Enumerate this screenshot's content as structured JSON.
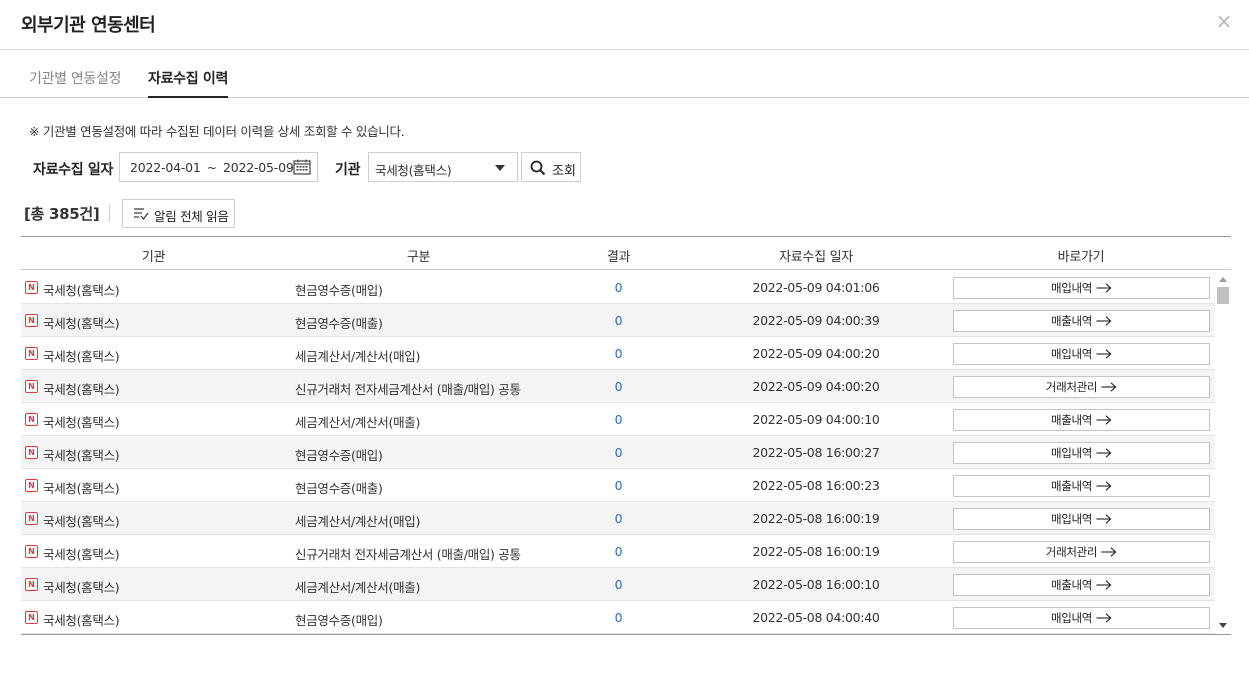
{
  "window": {
    "title": "외부기관 연동센터",
    "close_glyph": "×"
  },
  "tabs": [
    {
      "label": "기관별 연동설정",
      "active": false
    },
    {
      "label": "자료수집 이력",
      "active": true
    }
  ],
  "notice": "※ 기관별 연동설정에 따라 수집된 데이터 이력을 상세 조회할 수 있습니다.",
  "filters": {
    "date_label": "자료수집 일자",
    "date_from": "2022-04-01",
    "date_sep": "~",
    "date_to": "2022-05-09",
    "org_label": "기관",
    "org_value": "국세청(홈택스)",
    "search_label": "조회"
  },
  "summary": {
    "count_text": "[총 385건]",
    "read_all_label": "알림 전체 읽음"
  },
  "table": {
    "headers": [
      "기관",
      "구분",
      "결과",
      "자료수집 일자",
      "바로가기"
    ],
    "rows": [
      {
        "org": "국세청(홈택스)",
        "type": "현금영수증(매입)",
        "result": "0",
        "date": "2022-05-09 04:01:06",
        "link": "매입내역"
      },
      {
        "org": "국세청(홈택스)",
        "type": "현금영수증(매출)",
        "result": "0",
        "date": "2022-05-09 04:00:39",
        "link": "매출내역"
      },
      {
        "org": "국세청(홈택스)",
        "type": "세금계산서/계산서(매입)",
        "result": "0",
        "date": "2022-05-09 04:00:20",
        "link": "매입내역"
      },
      {
        "org": "국세청(홈택스)",
        "type": "신규거래처 전자세금계산서 (매출/매입) 공통",
        "result": "0",
        "date": "2022-05-09 04:00:20",
        "link": "거래처관리"
      },
      {
        "org": "국세청(홈택스)",
        "type": "세금계산서/계산서(매출)",
        "result": "0",
        "date": "2022-05-09 04:00:10",
        "link": "매출내역"
      },
      {
        "org": "국세청(홈택스)",
        "type": "현금영수증(매입)",
        "result": "0",
        "date": "2022-05-08 16:00:27",
        "link": "매입내역"
      },
      {
        "org": "국세청(홈택스)",
        "type": "현금영수증(매출)",
        "result": "0",
        "date": "2022-05-08 16:00:23",
        "link": "매출내역"
      },
      {
        "org": "국세청(홈택스)",
        "type": "세금계산서/계산서(매입)",
        "result": "0",
        "date": "2022-05-08 16:00:19",
        "link": "매입내역"
      },
      {
        "org": "국세청(홈택스)",
        "type": "신규거래처 전자세금계산서 (매출/매입) 공통",
        "result": "0",
        "date": "2022-05-08 16:00:19",
        "link": "거래처관리"
      },
      {
        "org": "국세청(홈택스)",
        "type": "세금계산서/계산서(매출)",
        "result": "0",
        "date": "2022-05-08 16:00:10",
        "link": "매출내역"
      },
      {
        "org": "국세청(홈택스)",
        "type": "현금영수증(매입)",
        "result": "0",
        "date": "2022-05-08 04:00:40",
        "link": "매입내역"
      }
    ]
  },
  "icons": {
    "org_badge": "N",
    "org_badge_color": "#e03b3b",
    "result_color": "#2e6dbe"
  }
}
